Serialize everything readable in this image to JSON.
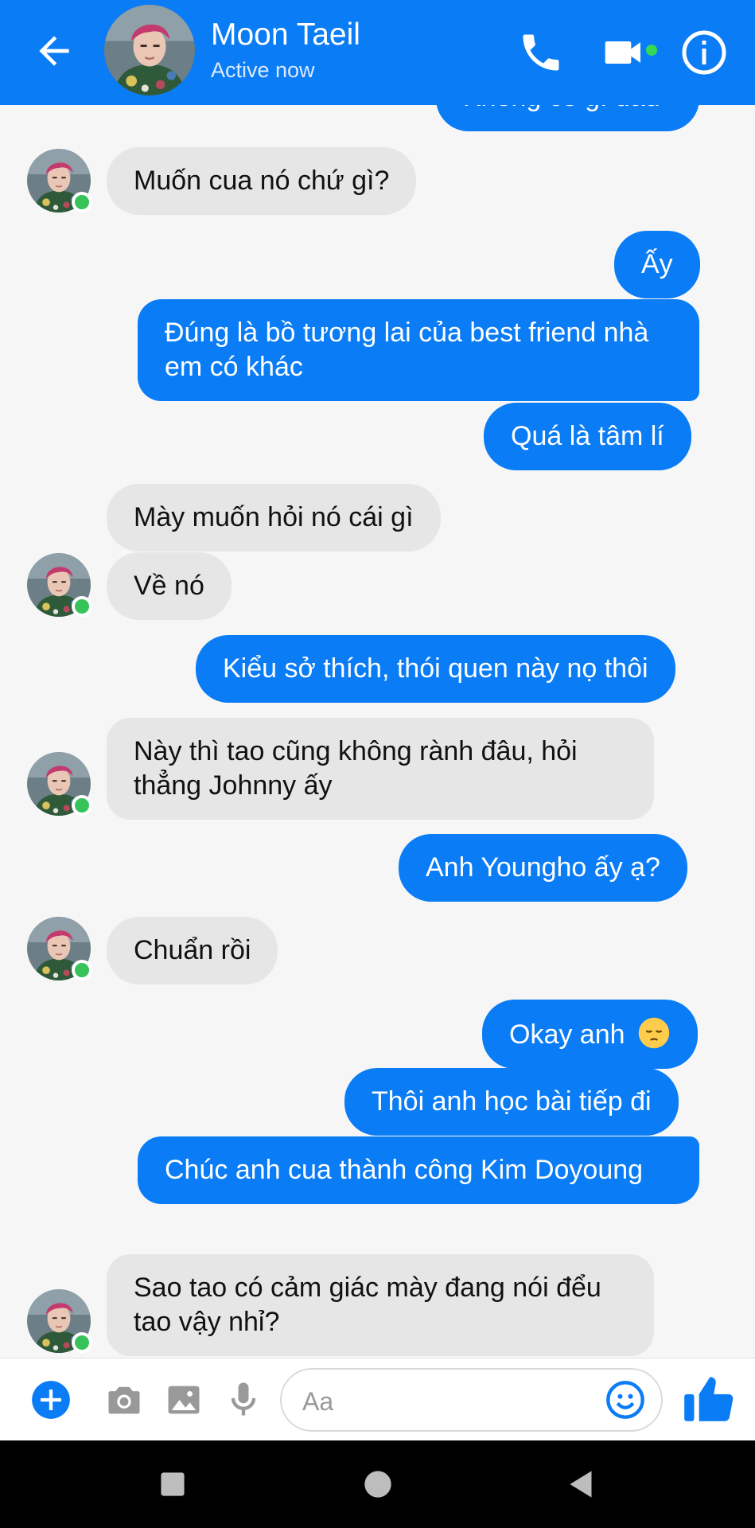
{
  "header": {
    "contact_name": "Moon Taeil",
    "status": "Active now"
  },
  "messages": [
    {
      "id": "m0",
      "from": "me",
      "text": "Không có gì đâu"
    },
    {
      "id": "m1",
      "from": "contact",
      "text": "Muốn cua nó chứ gì?"
    },
    {
      "id": "m2",
      "from": "me",
      "text": "Ấy"
    },
    {
      "id": "m3",
      "from": "me",
      "text": "Đúng là bồ tương lai của best friend nhà em có khác"
    },
    {
      "id": "m4",
      "from": "me",
      "text": "Quá là tâm lí"
    },
    {
      "id": "m5",
      "from": "contact",
      "text": "Mày muốn hỏi nó cái gì"
    },
    {
      "id": "m6",
      "from": "contact",
      "text": "Về nó"
    },
    {
      "id": "m7",
      "from": "me",
      "text": "Kiểu sở thích, thói quen này nọ thôi"
    },
    {
      "id": "m8",
      "from": "contact",
      "text": "Này thì tao cũng không rành đâu, hỏi thẳng Johnny ấy"
    },
    {
      "id": "m9",
      "from": "me",
      "text": "Anh Youngho ấy ạ?"
    },
    {
      "id": "m10",
      "from": "contact",
      "text": "Chuẩn rồi"
    },
    {
      "id": "m11",
      "from": "me",
      "text": "Okay anh",
      "emoji": "pensive-face"
    },
    {
      "id": "m12",
      "from": "me",
      "text": "Thôi anh học bài tiếp đi"
    },
    {
      "id": "m13",
      "from": "me",
      "text": "Chúc anh cua thành công Kim Doyoung"
    },
    {
      "id": "m14",
      "from": "contact",
      "text": "Sao tao có cảm giác mày đang nói đểu tao vậy nhỉ?"
    }
  ],
  "composer": {
    "placeholder": "Aa"
  },
  "colors": {
    "brand": "#0a7cf5",
    "incoming_bubble": "#e6e6e6",
    "online": "#35c35a"
  },
  "icons": {
    "header": [
      "back-arrow-icon",
      "phone-icon",
      "video-camera-icon",
      "info-icon"
    ],
    "composer": [
      "plus-icon",
      "camera-icon",
      "image-icon",
      "microphone-icon",
      "emoji-icon",
      "thumbs-up-icon"
    ],
    "nav": [
      "recent-apps-icon",
      "home-icon",
      "back-icon"
    ]
  }
}
